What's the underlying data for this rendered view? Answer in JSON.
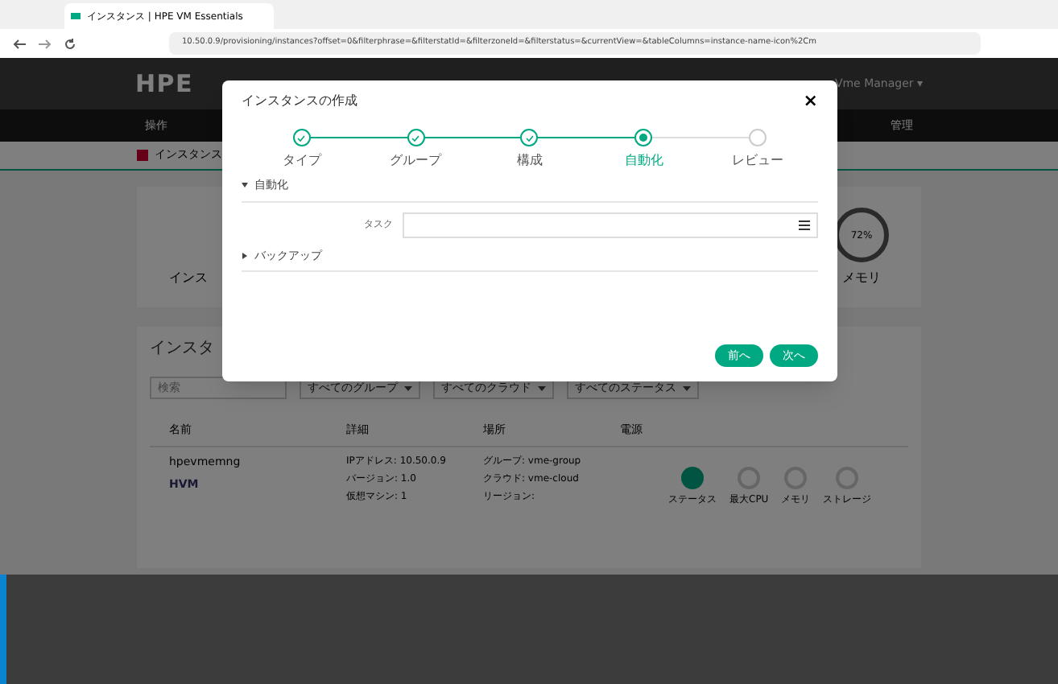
{
  "browser": {
    "tab_title": "インスタンス | HPE VM Essentials",
    "url": "10.50.0.9/provisioning/instances?offset=0&filterphrase=&filterstatId=&filterzoneId=&filterstatus=&currentView=&tableColumns=instance-name-icon%2Cm"
  },
  "header": {
    "logo": "HPE",
    "user": "Vme Manager ▾"
  },
  "nav": [
    {
      "label": "操作"
    },
    {
      "label": "管理"
    }
  ],
  "breadcrumb": "インスタンス",
  "stats": [
    {
      "label": "インス"
    },
    {
      "label": "メモリ",
      "reading": "72%"
    }
  ],
  "panel": {
    "title": "インスタ",
    "search_placeholder": "検索",
    "filters": [
      "すべてのグループ",
      "すべてのクラウド",
      "すべてのステータス"
    ],
    "columns": [
      "名前",
      "詳細",
      "場所",
      "電源"
    ],
    "rows": [
      {
        "name": "hpevmemng",
        "type": "HVM",
        "details": [
          "IPアドレス: 10.50.0.9",
          "バージョン: 1.0",
          "仮想マシン: 1"
        ],
        "location": [
          "グループ: vme-group",
          "クラウド: vme-cloud",
          "リージョン:"
        ],
        "gauges": [
          "ステータス",
          "最大CPU",
          "メモリ",
          "ストレージ"
        ]
      }
    ]
  },
  "dialog": {
    "title": "インスタンスの作成",
    "close": "×",
    "steps": [
      {
        "label": "タイプ",
        "completed": true,
        "selected": false
      },
      {
        "label": "グループ",
        "completed": true,
        "selected": false
      },
      {
        "label": "構成",
        "completed": true,
        "selected": false
      },
      {
        "label": "自動化",
        "completed": false,
        "selected": true
      },
      {
        "label": "レビュー",
        "completed": false,
        "selected": false
      }
    ],
    "sections": [
      {
        "title": "自動化",
        "expanded": true,
        "fields": [
          {
            "label": "タスク"
          }
        ]
      },
      {
        "title": "バックアップ",
        "expanded": false
      }
    ],
    "buttons": [
      "前へ",
      "次へ"
    ]
  }
}
